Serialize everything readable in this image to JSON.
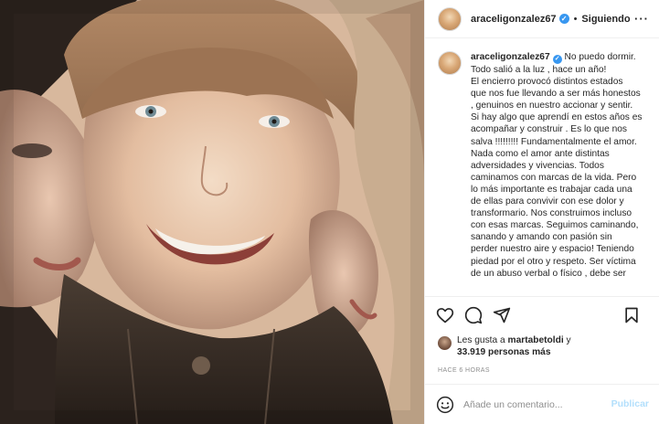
{
  "post": {
    "username": "araceligonzalez67",
    "follow_dot": "•",
    "follow_status": "Siguiendo",
    "more_label": "···",
    "verified_mark": "✓"
  },
  "caption": {
    "username": "araceligonzalez67",
    "lines": [
      "No puedo dormir.",
      "Todo salió a la luz , hace un año!",
      "El encierro provocó distintos estados",
      "que nos fue llevando a ser más honestos",
      ", genuinos en nuestro accionar y sentir.",
      "Si hay algo que aprendí en estos años es",
      "acompañar y construir . Es lo que nos",
      "salva !!!!!!!!! Fundamentalmente el amor.",
      "Nada como el amor ante distintas",
      "adversidades y vivencias. Todos",
      "caminamos con marcas de la vida. Pero",
      "lo más importante es trabajar cada una",
      "de ellas para convivir con ese dolor y",
      "transformario. Nos construimos incluso",
      "con esas marcas. Seguimos caminando,",
      "sanando y amando con pasión sin",
      "perder nuestro aire y espacio! Teniendo",
      "piedad por el otro y respeto. Ser víctima",
      "de un abuso verbal o físico , debe ser"
    ]
  },
  "likes": {
    "prefix": "Les gusta a",
    "liker": "martabetoldi",
    "connector": "y",
    "count": "33.919 personas más"
  },
  "timestamp": "HACE 6 HORAS",
  "comment": {
    "placeholder": "Añade un comentario...",
    "publish_label": "Publicar"
  },
  "colors": {
    "verified": "#3897f0",
    "publish_disabled": "#b2dffc",
    "muted": "#8e8e8e"
  },
  "icons": [
    "heart-icon",
    "comment-icon",
    "share-icon",
    "save-icon",
    "emoji-icon"
  ]
}
